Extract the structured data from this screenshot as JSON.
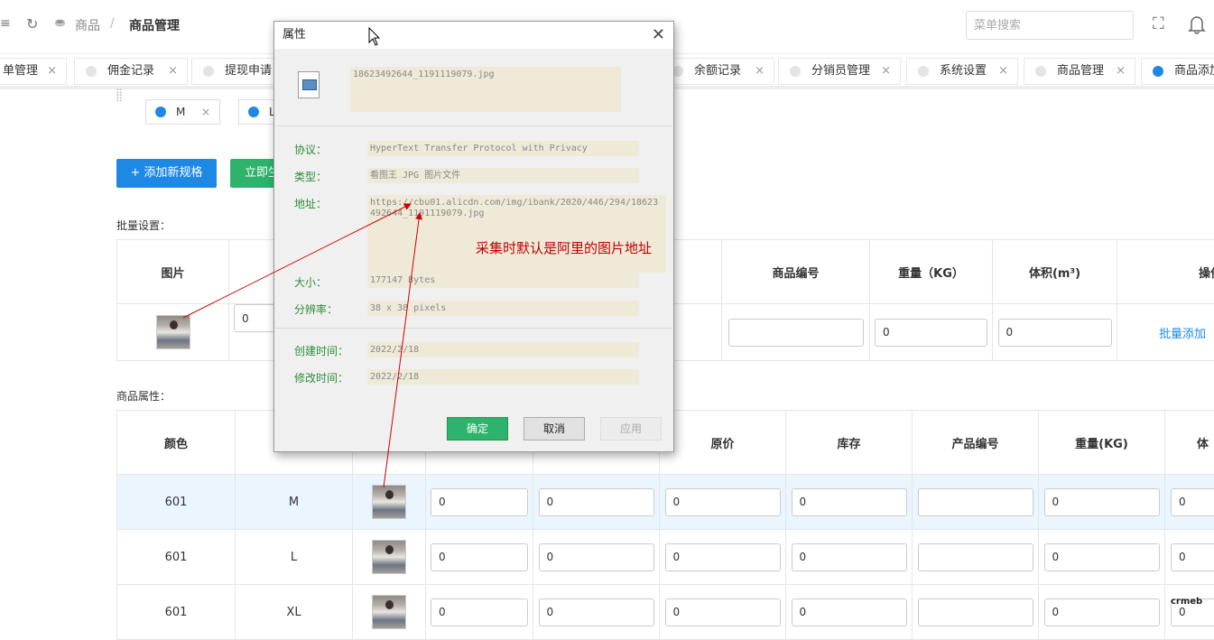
{
  "header": {
    "breadcrumb": {
      "parent": "商品",
      "separator": "/",
      "current": "商品管理"
    },
    "search_placeholder": "菜单搜索"
  },
  "tabs": [
    {
      "label": "单管理",
      "active": false
    },
    {
      "label": "佣金记录",
      "active": false
    },
    {
      "label": "提现申请",
      "active": false
    },
    {
      "label": "余额记录",
      "active": false
    },
    {
      "label": "分销员管理",
      "active": false
    },
    {
      "label": "系统设置",
      "active": false
    },
    {
      "label": "商品管理",
      "active": false
    },
    {
      "label": "商品添加",
      "active": true
    }
  ],
  "spec_chips": [
    "M",
    "L"
  ],
  "buttons": {
    "add_spec": "+ 添加新规格",
    "generate": "立即生成"
  },
  "batch": {
    "label": "批量设置：",
    "headers": [
      "图片",
      "商品编号",
      "重量（KG）",
      "体积(m³)",
      "操作"
    ],
    "values": [
      "0",
      "0",
      "0"
    ],
    "action": "批量添加"
  },
  "attrs": {
    "label": "商品属性：",
    "headers": [
      "颜色",
      "原价",
      "库存",
      "产品编号",
      "重量(KG)",
      "体"
    ],
    "rows": [
      {
        "color": "601",
        "size": "M"
      },
      {
        "color": "601",
        "size": "L"
      },
      {
        "color": "601",
        "size": "XL"
      }
    ],
    "input_value": "0"
  },
  "dialog": {
    "title": "属性",
    "filename": "18623492644_1191119079.jpg",
    "fields": [
      {
        "label": "协议：",
        "value": "HyperText Transfer Protocol with Privacy"
      },
      {
        "label": "类型：",
        "value": "看图王 JPG 图片文件"
      },
      {
        "label": "地址：",
        "value": "https://cbu01.alicdn.com/img/ibank/2020/446/294/18623492644_1191119079.jpg"
      },
      {
        "label": "大小：",
        "value": "177147 Bytes"
      },
      {
        "label": "分辨率：",
        "value": "38 x 38 pixels"
      },
      {
        "label": "创建时间：",
        "value": "2022/2/18"
      },
      {
        "label": "修改时间：",
        "value": "2022/2/18"
      }
    ],
    "buttons": {
      "ok": "确定",
      "cancel": "取消",
      "apply": "应用"
    }
  },
  "annotation": "采集时默认是阿里的图片地址",
  "watermark": "crmeb",
  "colors": {
    "primary": "#1e88e5",
    "success": "#2db36b",
    "annotation": "#c00000",
    "field_bg": "#efe9d7"
  }
}
